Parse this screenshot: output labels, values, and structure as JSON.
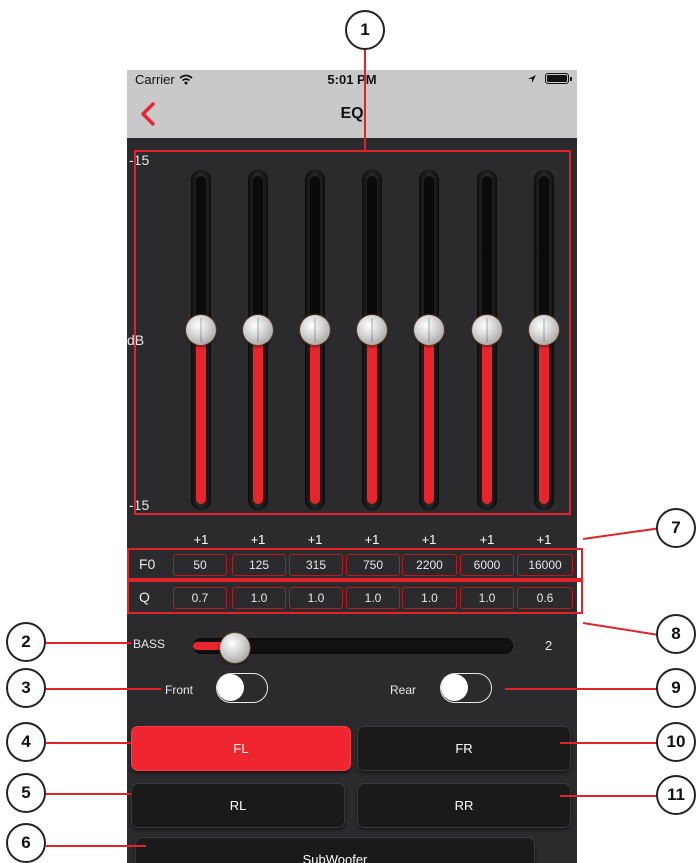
{
  "status_bar": {
    "carrier": "Carrier",
    "time": "5:01 PM"
  },
  "nav": {
    "title": "EQ"
  },
  "eq": {
    "top_label": "-15",
    "bottom_label": "-15",
    "unit_label": "dB",
    "gains": [
      "+1",
      "+1",
      "+1",
      "+1",
      "+1",
      "+1",
      "+1"
    ],
    "level_fraction": [
      0.53,
      0.53,
      0.53,
      0.53,
      0.53,
      0.53,
      0.53
    ]
  },
  "f0": {
    "label": "F0",
    "values": [
      "50",
      "125",
      "315",
      "750",
      "2200",
      "6000",
      "16000"
    ]
  },
  "q": {
    "label": "Q",
    "values": [
      "0.7",
      "1.0",
      "1.0",
      "1.0",
      "1.0",
      "1.0",
      "0.6"
    ]
  },
  "bass": {
    "label": "BASS",
    "value": "2",
    "level_fraction": 0.13
  },
  "toggles": {
    "front_label": "Front",
    "rear_label": "Rear"
  },
  "channels": {
    "fl": "FL",
    "fr": "FR",
    "rl": "RL",
    "rr": "RR",
    "sub": "SubWoofer"
  },
  "callouts": [
    "1",
    "2",
    "3",
    "4",
    "5",
    "6",
    "7",
    "8",
    "9",
    "10",
    "11"
  ],
  "colors": {
    "accent": "#ef2630",
    "background": "#2b2b2d",
    "header": "#c9c9c9"
  }
}
